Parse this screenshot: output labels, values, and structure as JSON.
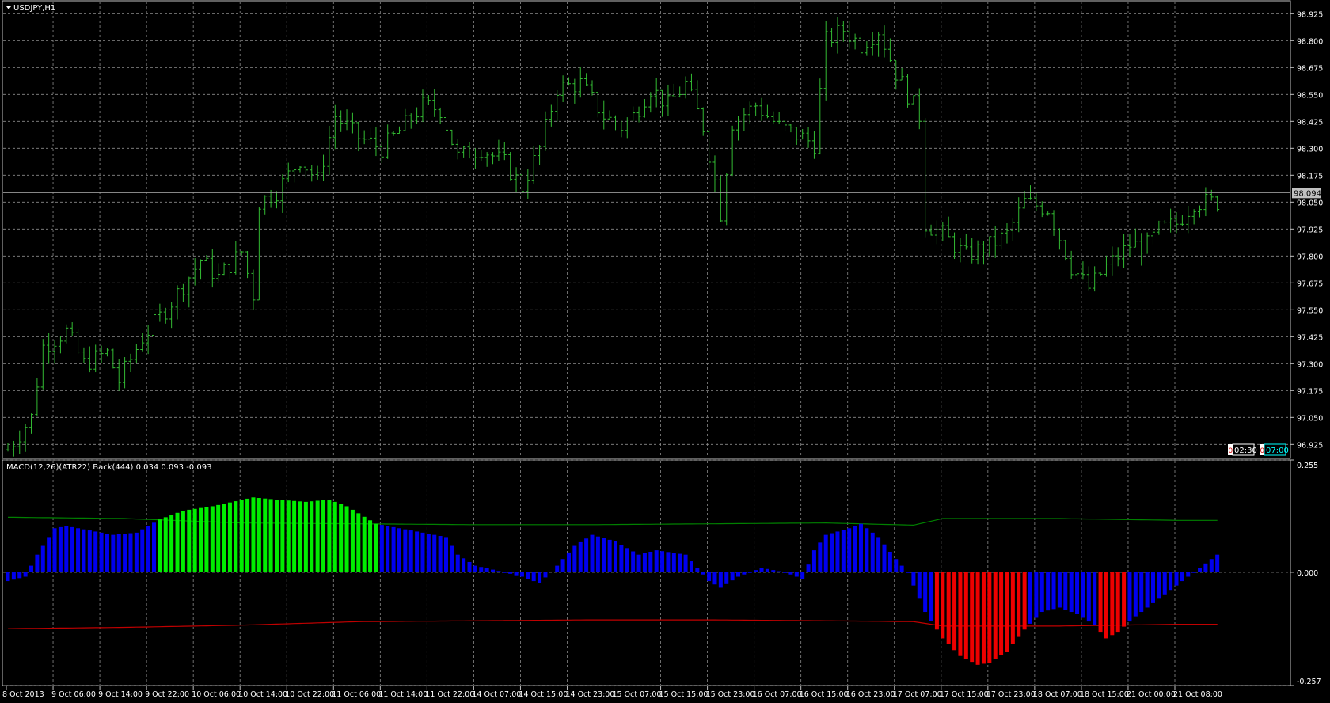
{
  "symbol_title": "USDJPY,H1",
  "indicator_title": "MACD(12,26)(ATR22) Back(444) 0.034 0.093 -0.093",
  "current_price": "98.094",
  "countdown_labels": [
    "02:30",
    "07:00"
  ],
  "colors": {
    "background": "#000000",
    "grid": "#8a8a8a",
    "frame": "#c0c0c0",
    "bars": "#33bb33",
    "price_line": "#9a9a9a",
    "hist_up": "#00ee00",
    "hist_neutral": "#0000ee",
    "hist_down": "#ee0000",
    "upper_band": "#008000",
    "lower_band": "#c00000",
    "axis_text": "#ffffff"
  },
  "chart_data": [
    {
      "type": "ohlc",
      "title": "USDJPY,H1",
      "price_axis_ticks": [
        "98.925",
        "98.800",
        "98.675",
        "98.550",
        "98.425",
        "98.300",
        "98.175",
        "98.050",
        "97.925",
        "97.800",
        "97.675",
        "97.550",
        "97.425",
        "97.300",
        "97.175",
        "97.050",
        "96.925"
      ],
      "ylim": [
        96.86,
        98.985
      ],
      "time_axis_ticks": [
        "8 Oct 2013",
        "9 Oct 06:00",
        "9 Oct 14:00",
        "9 Oct 22:00",
        "10 Oct 06:00",
        "10 Oct 14:00",
        "10 Oct 22:00",
        "11 Oct 06:00",
        "11 Oct 14:00",
        "11 Oct 22:00",
        "14 Oct 07:00",
        "14 Oct 15:00",
        "14 Oct 23:00",
        "15 Oct 07:00",
        "15 Oct 15:00",
        "15 Oct 23:00",
        "16 Oct 07:00",
        "16 Oct 15:00",
        "16 Oct 23:00",
        "17 Oct 07:00",
        "17 Oct 15:00",
        "17 Oct 23:00",
        "18 Oct 07:00",
        "18 Oct 15:00",
        "21 Oct 00:00",
        "21 Oct 08:00"
      ],
      "bars_per_tick": 8,
      "last_price": 98.094,
      "grid": true,
      "close_path": [
        [
          0,
          96.9
        ],
        [
          4,
          97.05
        ],
        [
          6,
          97.38
        ],
        [
          10,
          97.45
        ],
        [
          13,
          97.3
        ],
        [
          17,
          97.35
        ],
        [
          19,
          97.22
        ],
        [
          23,
          97.42
        ],
        [
          27,
          97.55
        ],
        [
          33,
          97.78
        ],
        [
          36,
          97.7
        ],
        [
          40,
          97.82
        ],
        [
          42,
          97.62
        ],
        [
          43,
          98.05
        ],
        [
          46,
          98.1
        ],
        [
          50,
          98.25
        ],
        [
          53,
          98.15
        ],
        [
          56,
          98.45
        ],
        [
          60,
          98.35
        ],
        [
          64,
          98.3
        ],
        [
          67,
          98.38
        ],
        [
          71,
          98.5
        ],
        [
          74,
          98.48
        ],
        [
          77,
          98.26
        ],
        [
          81,
          98.3
        ],
        [
          85,
          98.23
        ],
        [
          88,
          98.12
        ],
        [
          91,
          98.3
        ],
        [
          94,
          98.58
        ],
        [
          98,
          98.6
        ],
        [
          102,
          98.45
        ],
        [
          105,
          98.4
        ],
        [
          107,
          98.45
        ],
        [
          110,
          98.58
        ],
        [
          113,
          98.5
        ],
        [
          116,
          98.6
        ],
        [
          119,
          98.4
        ],
        [
          121,
          98.15
        ],
        [
          122,
          98.0
        ],
        [
          124,
          98.42
        ],
        [
          128,
          98.5
        ],
        [
          132,
          98.4
        ],
        [
          136,
          98.35
        ],
        [
          138,
          98.32
        ],
        [
          140,
          98.8
        ],
        [
          143,
          98.85
        ],
        [
          146,
          98.78
        ],
        [
          149,
          98.85
        ],
        [
          152,
          98.65
        ],
        [
          156,
          98.45
        ],
        [
          157,
          97.95
        ],
        [
          160,
          97.9
        ],
        [
          164,
          97.8
        ],
        [
          168,
          97.85
        ],
        [
          171,
          97.9
        ],
        [
          174,
          98.05
        ],
        [
          178,
          98.02
        ],
        [
          182,
          97.75
        ],
        [
          185,
          97.65
        ],
        [
          188,
          97.75
        ],
        [
          192,
          97.85
        ],
        [
          195,
          97.85
        ],
        [
          197,
          97.92
        ],
        [
          200,
          97.95
        ],
        [
          203,
          98.05
        ]
      ],
      "bar_range": 0.1
    },
    {
      "type": "bar",
      "title": "MACD(12,26)(ATR22) Back(444) 0.034 0.093 -0.093",
      "value_axis_ticks": [
        "0.255",
        "0.000",
        "-0.257"
      ],
      "ylim": [
        -0.257,
        0.255
      ],
      "bars_per_tick": 8,
      "histogram_path": [
        [
          0,
          -0.02
        ],
        [
          3,
          -0.01
        ],
        [
          5,
          0.04
        ],
        [
          8,
          0.1
        ],
        [
          10,
          0.105
        ],
        [
          14,
          0.095
        ],
        [
          18,
          0.085
        ],
        [
          22,
          0.09
        ],
        [
          26,
          0.12
        ],
        [
          30,
          0.14
        ],
        [
          35,
          0.15
        ],
        [
          42,
          0.17
        ],
        [
          46,
          0.165
        ],
        [
          51,
          0.16
        ],
        [
          55,
          0.165
        ],
        [
          58,
          0.15
        ],
        [
          63,
          0.11
        ],
        [
          67,
          0.1
        ],
        [
          71,
          0.09
        ],
        [
          75,
          0.08
        ],
        [
          77,
          0.04
        ],
        [
          80,
          0.015
        ],
        [
          85,
          0.0
        ],
        [
          88,
          -0.01
        ],
        [
          91,
          -0.025
        ],
        [
          94,
          0.015
        ],
        [
          97,
          0.06
        ],
        [
          100,
          0.085
        ],
        [
          104,
          0.07
        ],
        [
          108,
          0.04
        ],
        [
          111,
          0.05
        ],
        [
          116,
          0.04
        ],
        [
          118,
          0.01
        ],
        [
          120,
          -0.02
        ],
        [
          122,
          -0.035
        ],
        [
          125,
          -0.01
        ],
        [
          129,
          0.01
        ],
        [
          133,
          0.0
        ],
        [
          136,
          -0.015
        ],
        [
          138,
          0.05
        ],
        [
          140,
          0.085
        ],
        [
          144,
          0.1
        ],
        [
          146,
          0.11
        ],
        [
          149,
          0.08
        ],
        [
          152,
          0.03
        ],
        [
          154,
          0.0
        ],
        [
          157,
          -0.09
        ],
        [
          160,
          -0.15
        ],
        [
          163,
          -0.19
        ],
        [
          166,
          -0.21
        ],
        [
          168,
          -0.205
        ],
        [
          171,
          -0.18
        ],
        [
          174,
          -0.13
        ],
        [
          177,
          -0.09
        ],
        [
          180,
          -0.08
        ],
        [
          183,
          -0.095
        ],
        [
          186,
          -0.12
        ],
        [
          188,
          -0.15
        ],
        [
          190,
          -0.135
        ],
        [
          193,
          -0.1
        ],
        [
          196,
          -0.07
        ],
        [
          199,
          -0.04
        ],
        [
          202,
          -0.01
        ],
        [
          205,
          0.02
        ],
        [
          207,
          0.04
        ]
      ],
      "series": [
        {
          "name": "upper",
          "path": [
            [
              0,
              0.125
            ],
            [
              20,
              0.122
            ],
            [
              40,
              0.112
            ],
            [
              60,
              0.11
            ],
            [
              80,
              0.108
            ],
            [
              100,
              0.108
            ],
            [
              120,
              0.11
            ],
            [
              140,
              0.112
            ],
            [
              155,
              0.107
            ],
            [
              160,
              0.122
            ],
            [
              180,
              0.122
            ],
            [
              200,
              0.118
            ],
            [
              207,
              0.118
            ]
          ]
        },
        {
          "name": "lower",
          "path": [
            [
              0,
              -0.128
            ],
            [
              20,
              -0.125
            ],
            [
              40,
              -0.12
            ],
            [
              60,
              -0.112
            ],
            [
              80,
              -0.11
            ],
            [
              100,
              -0.108
            ],
            [
              120,
              -0.108
            ],
            [
              140,
              -0.11
            ],
            [
              155,
              -0.112
            ],
            [
              160,
              -0.122
            ],
            [
              180,
              -0.122
            ],
            [
              200,
              -0.118
            ],
            [
              207,
              -0.118
            ]
          ]
        }
      ],
      "color_rules": "green when above upper band, red when below lower band, blue otherwise"
    }
  ]
}
